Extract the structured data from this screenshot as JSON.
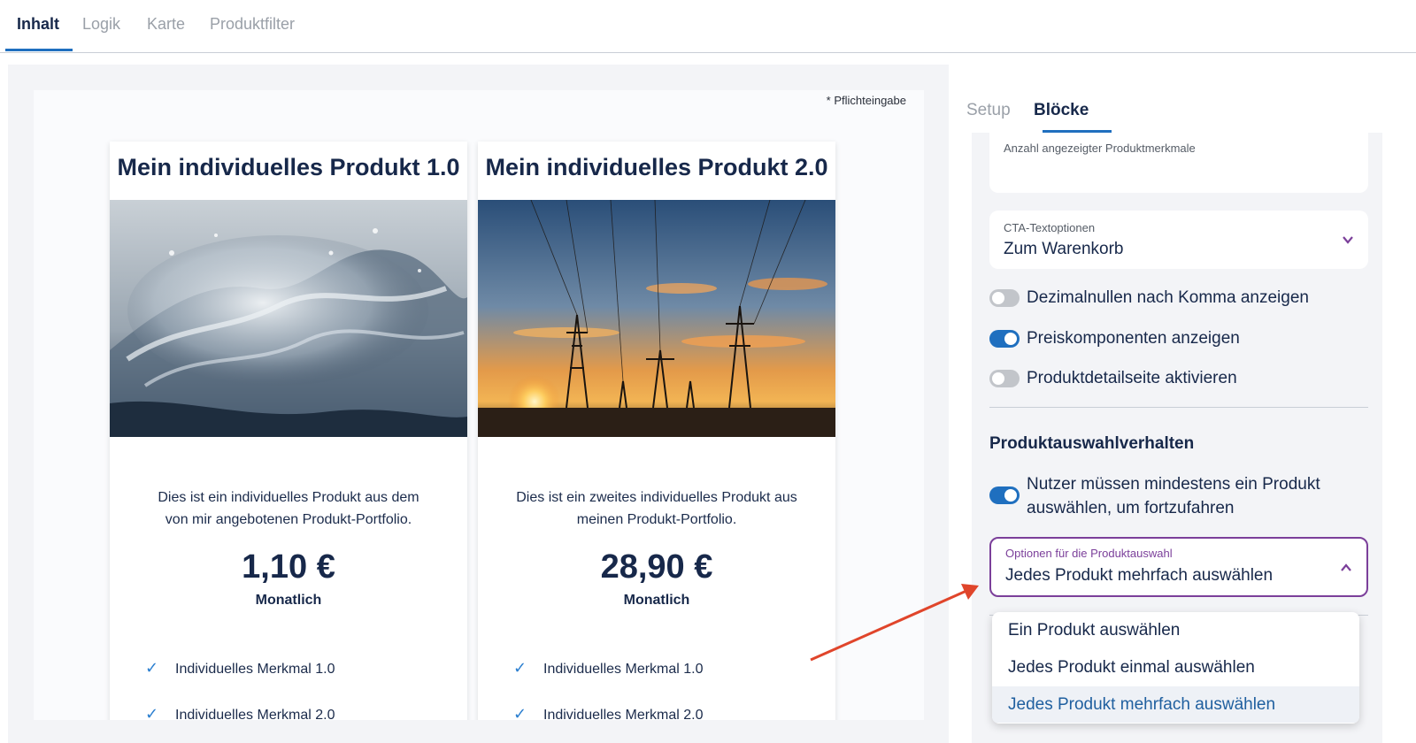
{
  "top_tabs": [
    "Inhalt",
    "Logik",
    "Karte",
    "Produktfilter"
  ],
  "preview": {
    "required_note": "* Pflichteingabe",
    "cards": [
      {
        "title": "Mein individuelles Produkt 1.0",
        "image": "water-splash",
        "desc_line1": "Dies ist ein individuelles Produkt aus dem",
        "desc_line2": "von mir angebotenen Produkt-Portfolio.",
        "price": "1,10 €",
        "period": "Monatlich",
        "features": [
          "Individuelles Merkmal 1.0",
          "Individuelles Merkmal 2.0"
        ]
      },
      {
        "title": "Mein individuelles Produkt 2.0",
        "image": "power-lines-sunset",
        "desc_line1": "Dies ist ein zweites individuelles Produkt aus",
        "desc_line2": "meinen Produkt-Portfolio.",
        "price": "28,90 €",
        "period": "Monatlich",
        "features": [
          "Individuelles Merkmal 1.0",
          "Individuelles Merkmal 2.0"
        ]
      }
    ]
  },
  "side": {
    "tabs": [
      "Setup",
      "Blöcke"
    ],
    "count_field_label": "Anzahl angezeigter Produktmerkmale",
    "cta": {
      "label": "CTA-Textoptionen",
      "value": "Zum Warenkorb"
    },
    "toggles": [
      {
        "label": "Dezimalnullen nach Komma anzeigen",
        "on": false
      },
      {
        "label": "Preiskomponenten anzeigen",
        "on": true
      },
      {
        "label": "Produktdetailseite aktivieren",
        "on": false
      }
    ],
    "section_title": "Produktauswahlverhalten",
    "min_select": {
      "line1": "Nutzer müssen mindestens ein Produkt",
      "line2": "auswählen, um fortzufahren",
      "on": true
    },
    "selection": {
      "label": "Optionen für die Produktauswahl",
      "value": "Jedes Produkt mehrfach auswählen",
      "options": [
        "Ein Produkt auswählen",
        "Jedes Produkt einmal auswählen",
        "Jedes Produkt mehrfach auswählen"
      ],
      "selected_index": 2
    }
  },
  "colors": {
    "accent": "#1f6fbf",
    "focus": "#7b3f9a",
    "arrow": "#e0452b",
    "text": "#17284a"
  }
}
